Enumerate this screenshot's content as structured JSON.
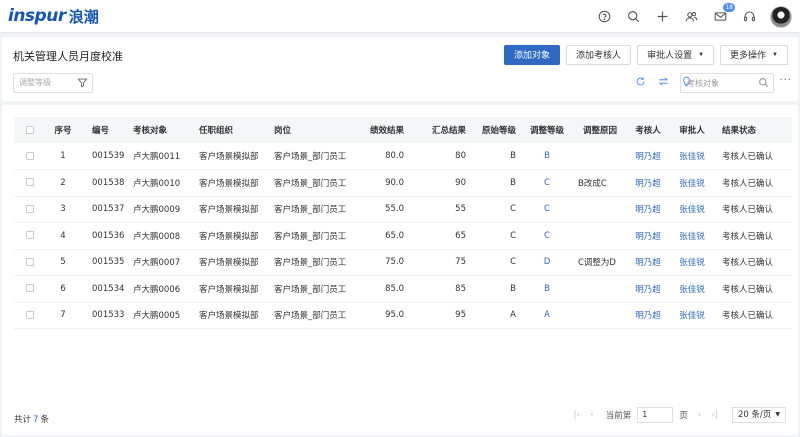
{
  "brand": {
    "logo_en": "inspur",
    "logo_cn": "浪潮",
    "color": "#1455b8"
  },
  "nav": {
    "icons": [
      "help-icon",
      "search-icon",
      "plus-icon",
      "people-icon",
      "mail-icon",
      "headset-icon"
    ],
    "mail_badge": "18"
  },
  "header": {
    "title": "机关管理人员月度校准",
    "buttons": {
      "add_target": "添加对象",
      "add_reviewer": "添加考核人",
      "approver_settings": "审批人设置",
      "more_actions": "更多操作"
    },
    "filter_placeholder": "调整等级",
    "search_placeholder": "考核对象"
  },
  "table": {
    "columns": [
      "序号",
      "编号",
      "考核对象",
      "任职组织",
      "岗位",
      "绩效结果",
      "汇总结果",
      "原始等级",
      "调整等级",
      "调整原因",
      "考核人",
      "审批人",
      "结果状态"
    ],
    "rows": [
      [
        "1",
        "001539",
        "卢大鹏0011",
        "客户场景模拟部",
        "客户场景_部门员工",
        "80.0",
        "80",
        "B",
        "B",
        "",
        "明乃超",
        "张佳锐",
        "考核人已确认"
      ],
      [
        "2",
        "001538",
        "卢大鹏0010",
        "客户场景模拟部",
        "客户场景_部门员工",
        "90.0",
        "90",
        "B",
        "C",
        "B改成C",
        "明乃超",
        "张佳锐",
        "考核人已确认"
      ],
      [
        "3",
        "001537",
        "卢大鹏0009",
        "客户场景模拟部",
        "客户场景_部门员工",
        "55.0",
        "55",
        "C",
        "C",
        "",
        "明乃超",
        "张佳锐",
        "考核人已确认"
      ],
      [
        "4",
        "001536",
        "卢大鹏0008",
        "客户场景模拟部",
        "客户场景_部门员工",
        "65.0",
        "65",
        "C",
        "C",
        "",
        "明乃超",
        "张佳锐",
        "考核人已确认"
      ],
      [
        "5",
        "001535",
        "卢大鹏0007",
        "客户场景模拟部",
        "客户场景_部门员工",
        "75.0",
        "75",
        "C",
        "D",
        "C调整为D",
        "明乃超",
        "张佳锐",
        "考核人已确认"
      ],
      [
        "6",
        "001534",
        "卢大鹏0006",
        "客户场景模拟部",
        "客户场景_部门员工",
        "85.0",
        "85",
        "B",
        "B",
        "",
        "明乃超",
        "张佳锐",
        "考核人已确认"
      ],
      [
        "7",
        "001533",
        "卢大鹏0005",
        "客户场景模拟部",
        "客户场景_部门员工",
        "95.0",
        "95",
        "A",
        "A",
        "",
        "明乃超",
        "张佳锐",
        "考核人已确认"
      ]
    ]
  },
  "footer": {
    "total_prefix": "共计",
    "total_count": "7",
    "total_suffix": "条",
    "page_prefix": "当前第",
    "page_value": "1",
    "page_suffix": "页",
    "page_size": "20 条/页"
  },
  "colors": {
    "accent": "#2e69c4",
    "link": "#2e69c4",
    "badge": "#4d8ef5"
  }
}
